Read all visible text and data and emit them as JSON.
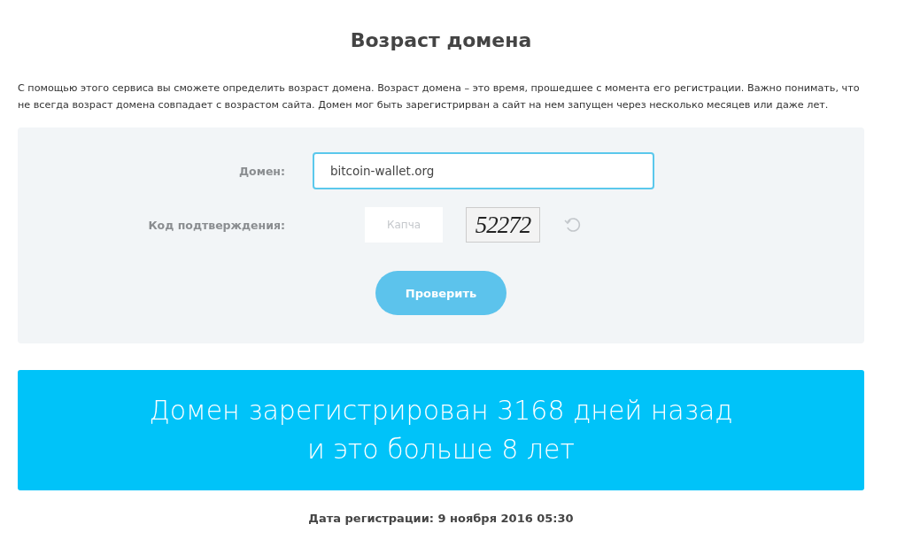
{
  "title": "Возраст домена",
  "description": "С помощью этого сервиса вы сможете определить возраст домена. Возраст домена – это время, прошедшее с момента его регистрации. Важно понимать, что не всегда возраст домена совпадает с возрастом сайта. Домен мог быть зарегистрирван а сайт на нем запущен через несколько месяцев или даже лет.",
  "form": {
    "domain_label": "Домен:",
    "domain_value": "bitcoin-wallet.org",
    "captcha_label": "Код подтверждения:",
    "captcha_placeholder": "Капча",
    "captcha_code": "52272",
    "submit": "Проверить"
  },
  "result": {
    "lines": [
      "Домен зарегистрирован 3168 дней назад",
      "и это больше 8 лет"
    ]
  },
  "registration_date": "Дата регистрации: 9 ноября 2016 05:30"
}
